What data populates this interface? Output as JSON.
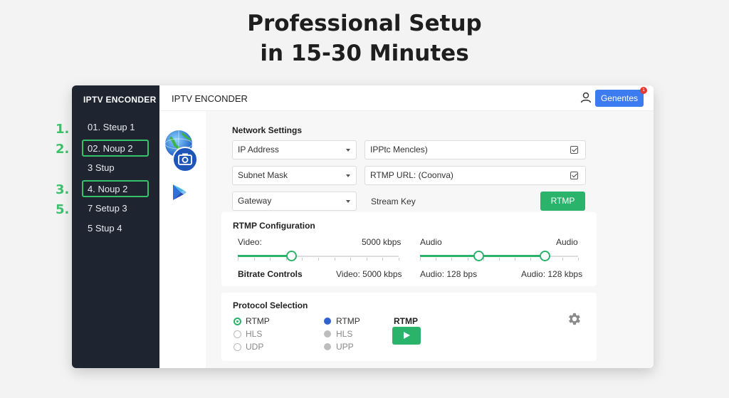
{
  "headline": {
    "line1": "Professional Setup",
    "line2": "in 15-30 Minutes"
  },
  "step_numbers": [
    "1.",
    "2.",
    "3.",
    "5."
  ],
  "sidebar": {
    "title": "IPTV ENCONDER",
    "items": [
      {
        "label": "01. Steup 1",
        "highlighted": false
      },
      {
        "label": "02. Noup 2",
        "highlighted": true
      },
      {
        "label": "3  Stup",
        "highlighted": false
      },
      {
        "label": "4. Noup 2",
        "highlighted": true
      },
      {
        "label": "7  Setup 3",
        "highlighted": false
      },
      {
        "label": "5  Stup 4",
        "highlighted": false
      }
    ]
  },
  "topbar": {
    "title": "IPTV ENCONDER",
    "button": "Genentes",
    "notification_count": "1"
  },
  "network": {
    "title": "Network Settings",
    "dropdowns": [
      "IP Address",
      "Subnet Mask",
      "Gateway"
    ],
    "checkbox_fields": [
      "IPPtc Mencles)",
      "RTMP URL: (Coonva)"
    ],
    "stream_key_label": "Stream Key",
    "rtmp_button": "RTMP"
  },
  "rtmp_config": {
    "title": "RTMP Configuration",
    "video_label": "Video:",
    "video_value": "5000 kbps",
    "audio_label": "Audio",
    "audio_label_right": "Audio",
    "bitrate_label": "Bitrate Controls",
    "video_readout": "Video: 5000 kbps",
    "audio_readout_left": "Audio: 128 bps",
    "audio_readout_right": "Audio: 128 kbps",
    "video_slider_fraction": 0.33,
    "audio_slider_low_fraction": 0.37,
    "audio_slider_high_fraction": 0.79
  },
  "protocol": {
    "title": "Protocol Selection",
    "group1": [
      "RTMP",
      "HLS",
      "UDP"
    ],
    "group2": [
      "RTMP",
      "HLS",
      "UPP"
    ],
    "play_label": "RTMP"
  },
  "colors": {
    "accent_green": "#2ab36a",
    "highlight_green": "#3cc26a",
    "primary_blue": "#3d7cf0",
    "sidebar_bg": "#1e2530"
  },
  "icons": [
    "globe-icon",
    "camera-icon",
    "play-store-icon",
    "user-icon",
    "gear-icon"
  ]
}
